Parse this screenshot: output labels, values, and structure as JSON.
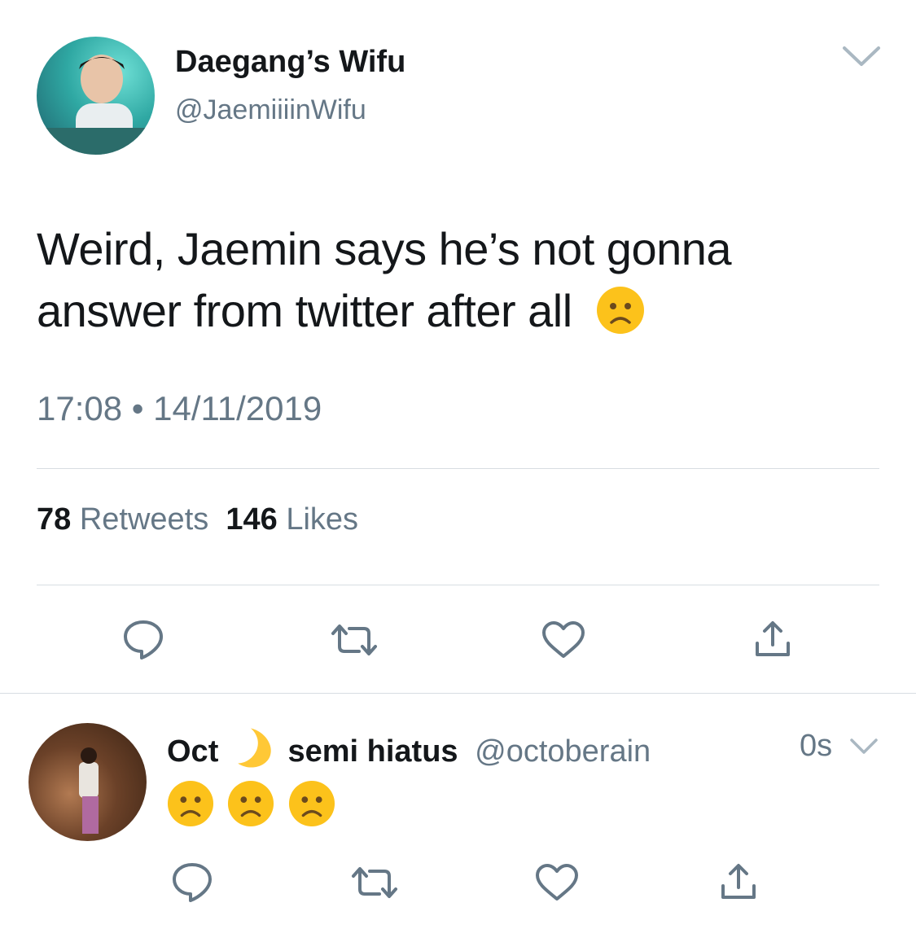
{
  "tweet": {
    "display_name": "Daegang’s Wifu",
    "handle": "@JaemiiiinWifu",
    "text": "Weird, Jaemin says he’s not gonna answer from twitter after all",
    "emoji": "frowning-face",
    "timestamp": "17:08 • 14/11/2019",
    "retweets_count": "78",
    "retweets_label": "Retweets",
    "likes_count": "146",
    "likes_label": "Likes"
  },
  "reply": {
    "name_part1": "Oct",
    "name_emoji": "crescent-moon",
    "name_part2": "semi hiatus",
    "handle": "@octoberain",
    "time": "0s",
    "emojis": [
      "frowning-face",
      "frowning-face",
      "frowning-face"
    ]
  },
  "colors": {
    "text": "#14171a",
    "secondary": "#657786",
    "icon": "#657786",
    "divider": "#d7dde2"
  }
}
